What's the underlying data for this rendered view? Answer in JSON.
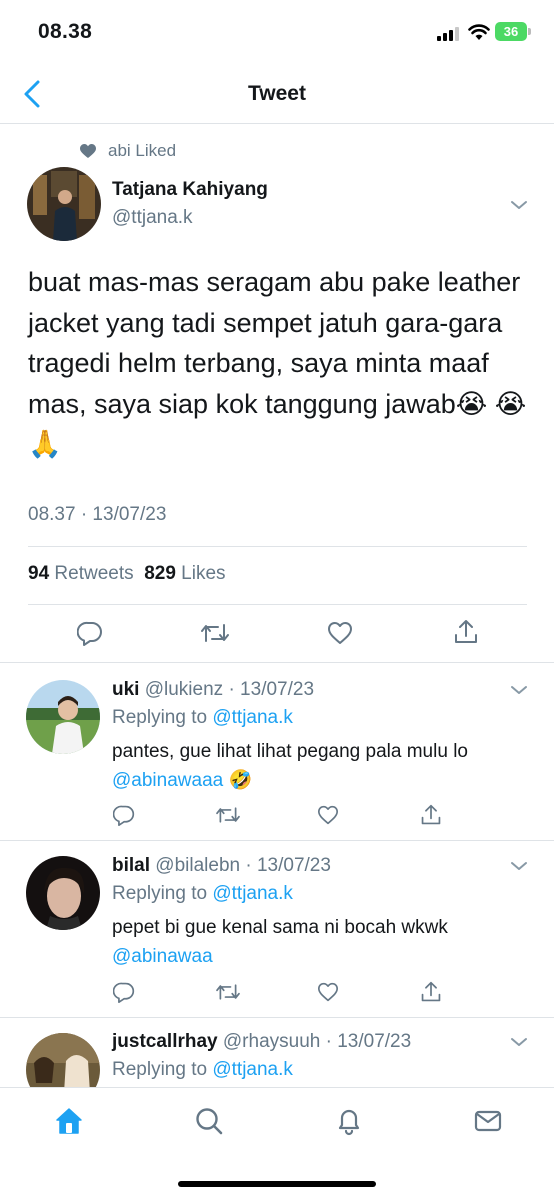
{
  "status_bar": {
    "time": "08.38",
    "battery": "36"
  },
  "header": {
    "title": "Tweet"
  },
  "main_tweet": {
    "social_context": "abi Liked",
    "author_name": "Tatjana Kahiyang",
    "author_handle": "@ttjana.k",
    "text": "buat mas-mas seragam abu pake leather jacket yang tadi sempet jatuh gara-gara tragedi helm terbang, saya minta maaf mas, saya siap kok tanggung jawab😭 😭 🙏",
    "timestamp": "08.37 · 13/07/23",
    "retweets_count": "94",
    "retweets_label": "Retweets",
    "likes_count": "829",
    "likes_label": "Likes"
  },
  "replies": [
    {
      "name": "uki",
      "handle": "@lukienz",
      "date": "· 13/07/23",
      "replying_label": "Replying to",
      "replying_to": "@ttjana.k",
      "text": "pantes, gue lihat lihat pegang pala mulu lo",
      "mention": "@abinawaaa",
      "emoji": "🤣"
    },
    {
      "name": "bilal",
      "handle": "@bilalebn",
      "date": "· 13/07/23",
      "replying_label": "Replying to",
      "replying_to": "@ttjana.k",
      "text": "pepet bi gue kenal sama ni bocah wkwk",
      "mention": "@abinawaa",
      "emoji": ""
    },
    {
      "name": "justcallrhay",
      "handle": "@rhaysuuh",
      "date": "· 13/07/23",
      "replying_label": "Replying to",
      "replying_to": "@ttjana.k"
    }
  ],
  "icons": {
    "back": "chevron-left-icon",
    "reply": "reply-icon",
    "retweet": "retweet-icon",
    "like": "heart-icon",
    "share": "share-icon",
    "home": "home-icon",
    "search": "search-icon",
    "notifications": "bell-icon",
    "messages": "mail-icon"
  },
  "colors": {
    "accent": "#1da1f2",
    "muted": "#657786",
    "text": "#14171a",
    "divider": "#dfe3e7",
    "battery": "#4cd964"
  }
}
